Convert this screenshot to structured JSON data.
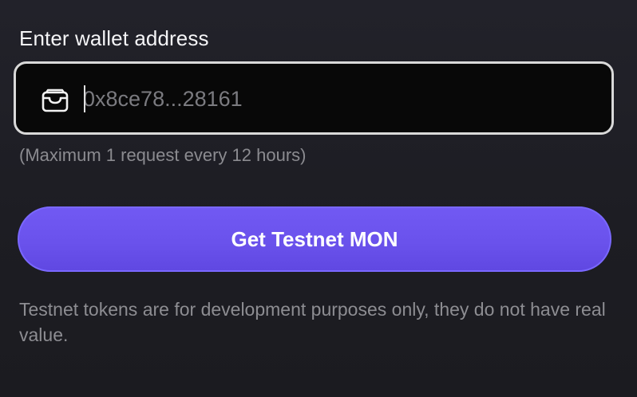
{
  "form": {
    "label": "Enter wallet address",
    "address_placeholder": "0x8ce78...28161",
    "hint": "(Maximum 1 request every 12 hours)",
    "submit_label": "Get Testnet MON",
    "disclaimer": "Testnet tokens are for development purposes only, they do not have real value."
  },
  "icons": {
    "wallet": "wallet-icon"
  },
  "colors": {
    "accent": "#6a52ec",
    "input_border": "#d9d9d9",
    "input_background": "#080808",
    "background": "#1f1f25",
    "muted_text": "#8b8b90"
  }
}
